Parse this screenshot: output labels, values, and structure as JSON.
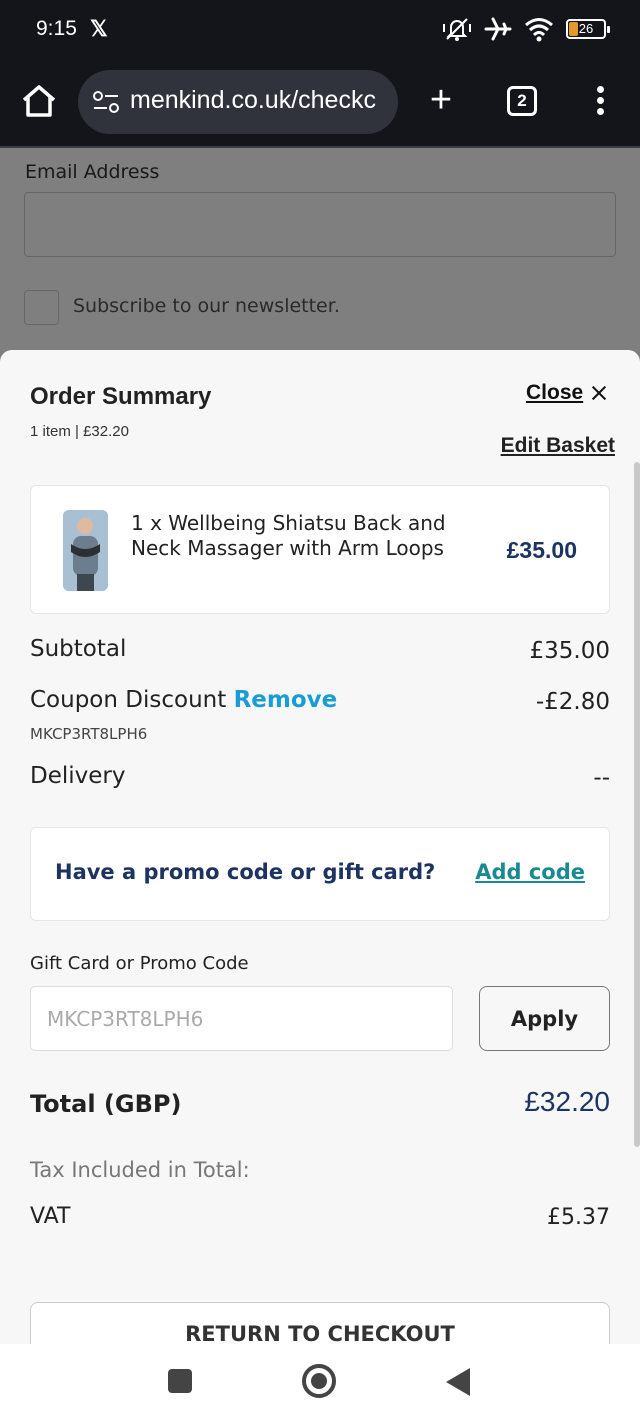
{
  "status_bar": {
    "time": "9:15",
    "x_logo": "𝕏",
    "battery_level": "26",
    "battery_fraction": 0.26,
    "icons": [
      "mute-vibrate-icon",
      "airplane-icon",
      "wifi-icon",
      "battery-icon"
    ]
  },
  "browser": {
    "url": "menkind.co.uk/checkc",
    "tab_count": "2",
    "new_tab_label": "+",
    "icons": [
      "home-icon",
      "site-settings-icon",
      "new-tab-icon",
      "tabs-icon",
      "menu-icon"
    ]
  },
  "background_page": {
    "email_label": "Email Address",
    "newsletter_label": "Subscribe to our newsletter."
  },
  "order_summary": {
    "title": "Order Summary",
    "subtitle": "1 item | £32.20",
    "close_label": "Close",
    "edit_basket_label": "Edit Basket",
    "product": {
      "name": "1 x Wellbeing Shiatsu Back and Neck Massager with Arm Loops",
      "price": "£35.00"
    },
    "subtotal_label": "Subtotal",
    "subtotal_value": "£35.00",
    "coupon_label": "Coupon Discount",
    "coupon_remove": "Remove",
    "coupon_value": "-£2.80",
    "coupon_code": "MKCP3RT8LPH6",
    "delivery_label": "Delivery",
    "delivery_value": "--",
    "promo_question": "Have a promo code or gift card?",
    "add_code_label": "Add code",
    "gift_field_label": "Gift Card or Promo Code",
    "gift_field_placeholder": "MKCP3RT8LPH6",
    "apply_label": "Apply",
    "total_label": "Total (GBP)",
    "total_value": "£32.20",
    "tax_label": "Tax Included in Total:",
    "vat_label": "VAT",
    "vat_value": "£5.37",
    "return_label": "RETURN TO CHECKOUT"
  },
  "colors": {
    "brand_navy": "#1d3361",
    "link_blue": "#1a9dd5",
    "link_teal": "#1a8a92",
    "battery_fill": "#e39a2a"
  }
}
